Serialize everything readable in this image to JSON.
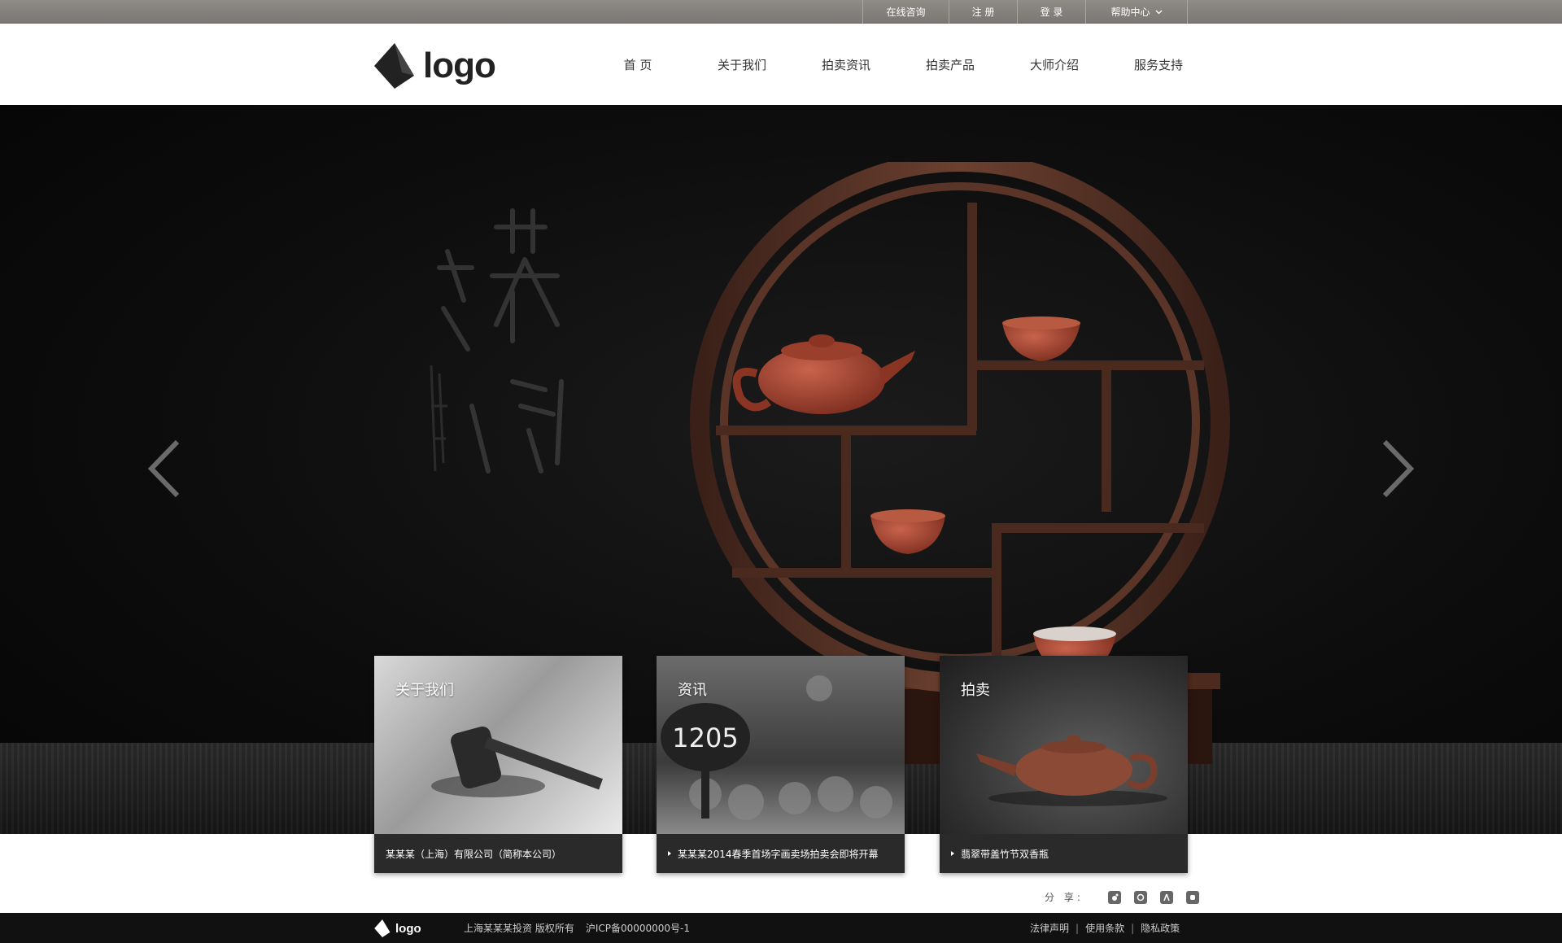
{
  "topbar": {
    "links": [
      "在线咨询",
      "注 册",
      "登 录",
      "帮助中心"
    ]
  },
  "header": {
    "logo_text": "logo",
    "nav": [
      "首 页",
      "关于我们",
      "拍卖资讯",
      "拍卖产品",
      "大师介绍",
      "服务支持"
    ]
  },
  "hero": {
    "slide_text": [
      "1205"
    ]
  },
  "cards": [
    {
      "title": "关于我们",
      "caption": "某某某（上海）有限公司（简称本公司）"
    },
    {
      "title": "资讯",
      "caption": "某某某2014春季首场字画卖场拍卖会即将开幕"
    },
    {
      "title": "拍卖",
      "caption": "翡翠带盖竹节双香瓶"
    }
  ],
  "share": {
    "label": "分 享:",
    "icons": [
      "weibo-icon",
      "tencent-icon",
      "renren-icon",
      "qzone-icon"
    ]
  },
  "footer": {
    "logo_text": "logo",
    "company": "上海某某某投资 版权所有",
    "icp": "沪ICP备00000000号-1",
    "links": [
      "法律声明",
      "使用条款",
      "隐私政策"
    ]
  }
}
